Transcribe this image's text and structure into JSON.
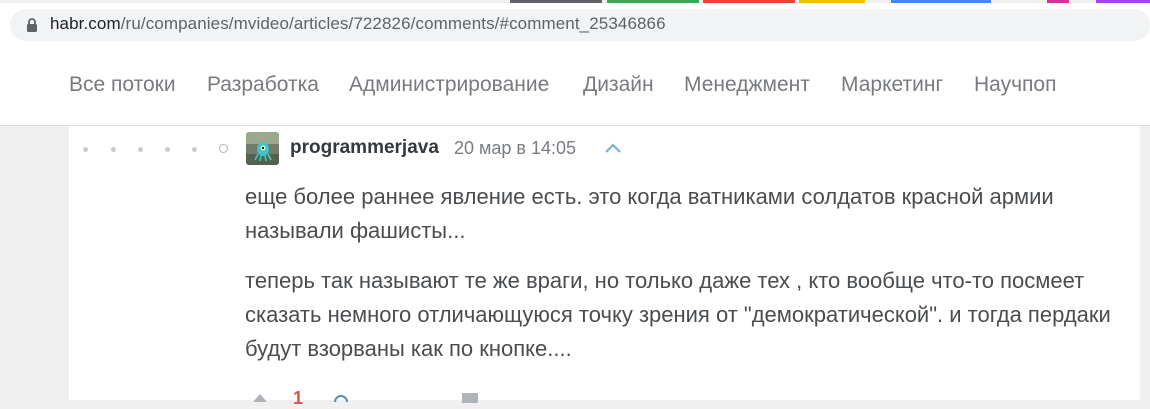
{
  "browser": {
    "url_host": "habr.com",
    "url_path": "/ru/companies/mvideo/articles/722826/comments/#comment_25346866",
    "tab_colors": [
      "#5f6368",
      "#34a853",
      "#ea4335",
      "#fbbc04",
      "#4285f4",
      "#d93095",
      "#a142f4"
    ]
  },
  "nav": {
    "items": [
      "Все потоки",
      "Разработка",
      "Администрирование",
      "Дизайн",
      "Менеджмент",
      "Маркетинг",
      "Научпоп"
    ]
  },
  "comment": {
    "author": "programmerjava",
    "time": "20 мар в 14:05",
    "paragraphs": [
      "еще более раннее явление есть. это когда ватниками солдатов красной армии называли фашисты...",
      "теперь так называют те же враги, но только даже тех , кто вообще что-то посмеет сказать немного отличающуюся точку зрения от \"демократической\". и тогда пердаки будут взорваны как по кнопке...."
    ],
    "score": "1",
    "icons": {
      "avatar": "user-avatar-icon",
      "parent": "chevron-up-icon",
      "vote_up": "vote-up-icon",
      "bookmark": "bookmark-icon",
      "flag": "flag-icon"
    }
  }
}
